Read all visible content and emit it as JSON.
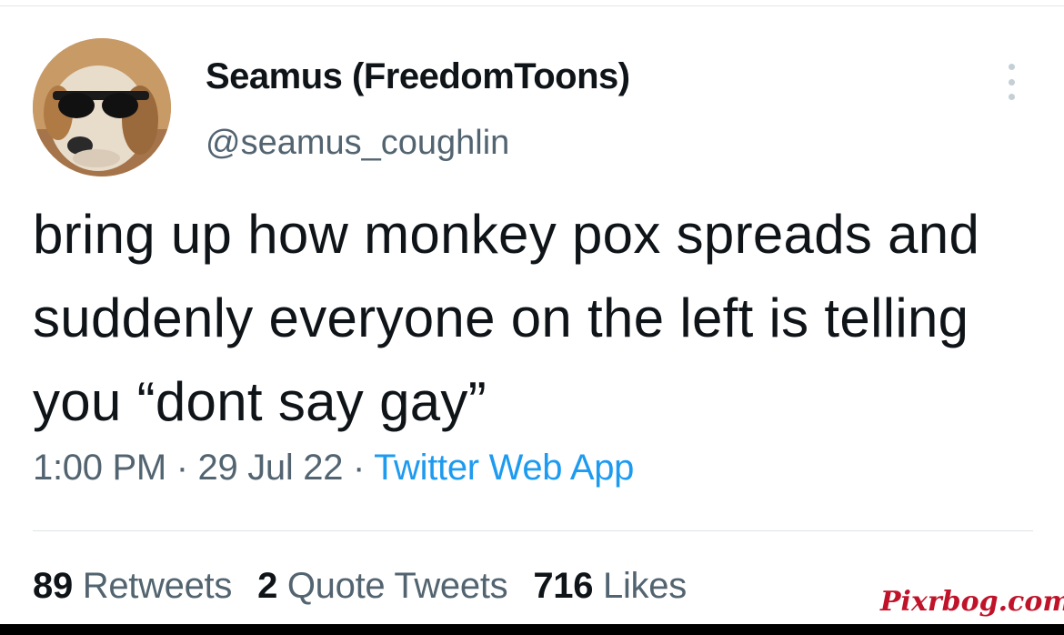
{
  "tweet": {
    "display_name": "Seamus (FreedomToons)",
    "handle": "@seamus_coughlin",
    "text": "bring up how monkey pox spreads and suddenly everyone on the left is telling you “dont say gay”",
    "time": "1:00 PM",
    "date": "29 Jul 22",
    "source": "Twitter Web App",
    "separator": " · "
  },
  "stats": {
    "retweets": {
      "count": "89",
      "label": "Retweets"
    },
    "quotes": {
      "count": "2",
      "label": "Quote Tweets"
    },
    "likes": {
      "count": "716",
      "label": "Likes"
    }
  },
  "avatar": {
    "description_icon": "dog-with-sunglasses-avatar"
  },
  "more_menu": {
    "icon": "more-vertical-icon"
  },
  "watermark": "Pixrbog.com",
  "colors": {
    "text": "#0f1419",
    "secondary": "#536471",
    "link": "#1d9bf0",
    "watermark": "#c0132a"
  }
}
